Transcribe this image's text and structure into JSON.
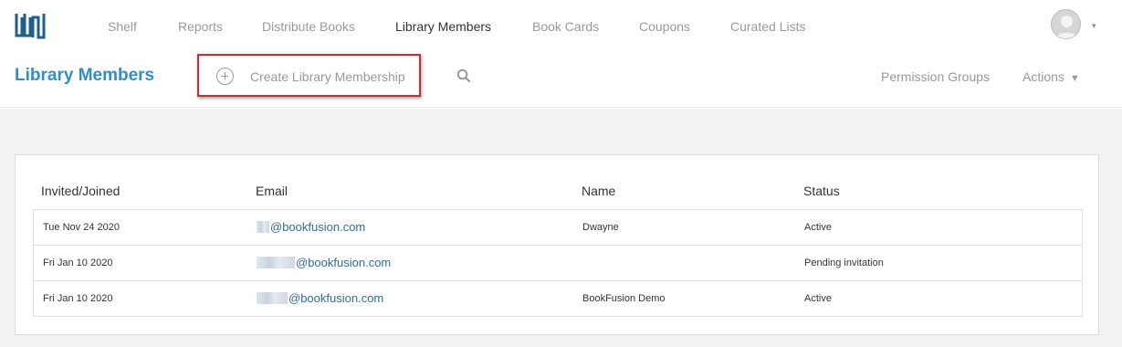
{
  "nav": {
    "items": [
      {
        "label": "Shelf",
        "active": false
      },
      {
        "label": "Reports",
        "active": false
      },
      {
        "label": "Distribute Books",
        "active": false
      },
      {
        "label": "Library Members",
        "active": true
      },
      {
        "label": "Book Cards",
        "active": false
      },
      {
        "label": "Coupons",
        "active": false
      },
      {
        "label": "Curated Lists",
        "active": false
      }
    ],
    "user_menu_caret": "▾"
  },
  "subheader": {
    "title": "Library Members",
    "create_label": "Create Library Membership",
    "permission_groups_label": "Permission Groups",
    "actions_label": "Actions",
    "actions_caret": "▼"
  },
  "table": {
    "headers": [
      "Invited/Joined",
      "Email",
      "Name",
      "Status"
    ],
    "rows": [
      {
        "date": "Tue Nov 24 2020",
        "email": "@bookfusion.com",
        "name": "Dwayne",
        "status": "Active"
      },
      {
        "date": "Fri Jan 10 2020",
        "email": "@bookfusion.com",
        "name": "",
        "status": "Pending invitation"
      },
      {
        "date": "Fri Jan 10 2020",
        "email": "@bookfusion.com",
        "name": "BookFusion Demo",
        "status": "Active"
      }
    ]
  },
  "colors": {
    "accent": "#2f8fc9",
    "link": "#2f6e9f",
    "highlight_border": "#d9262c",
    "muted_text": "#999999",
    "content_bg": "#f2f2f2"
  },
  "icons": {
    "logo": "bookfusion-logo",
    "avatar": "user-avatar-icon",
    "create": "plus-circle-icon",
    "search": "search-icon"
  }
}
